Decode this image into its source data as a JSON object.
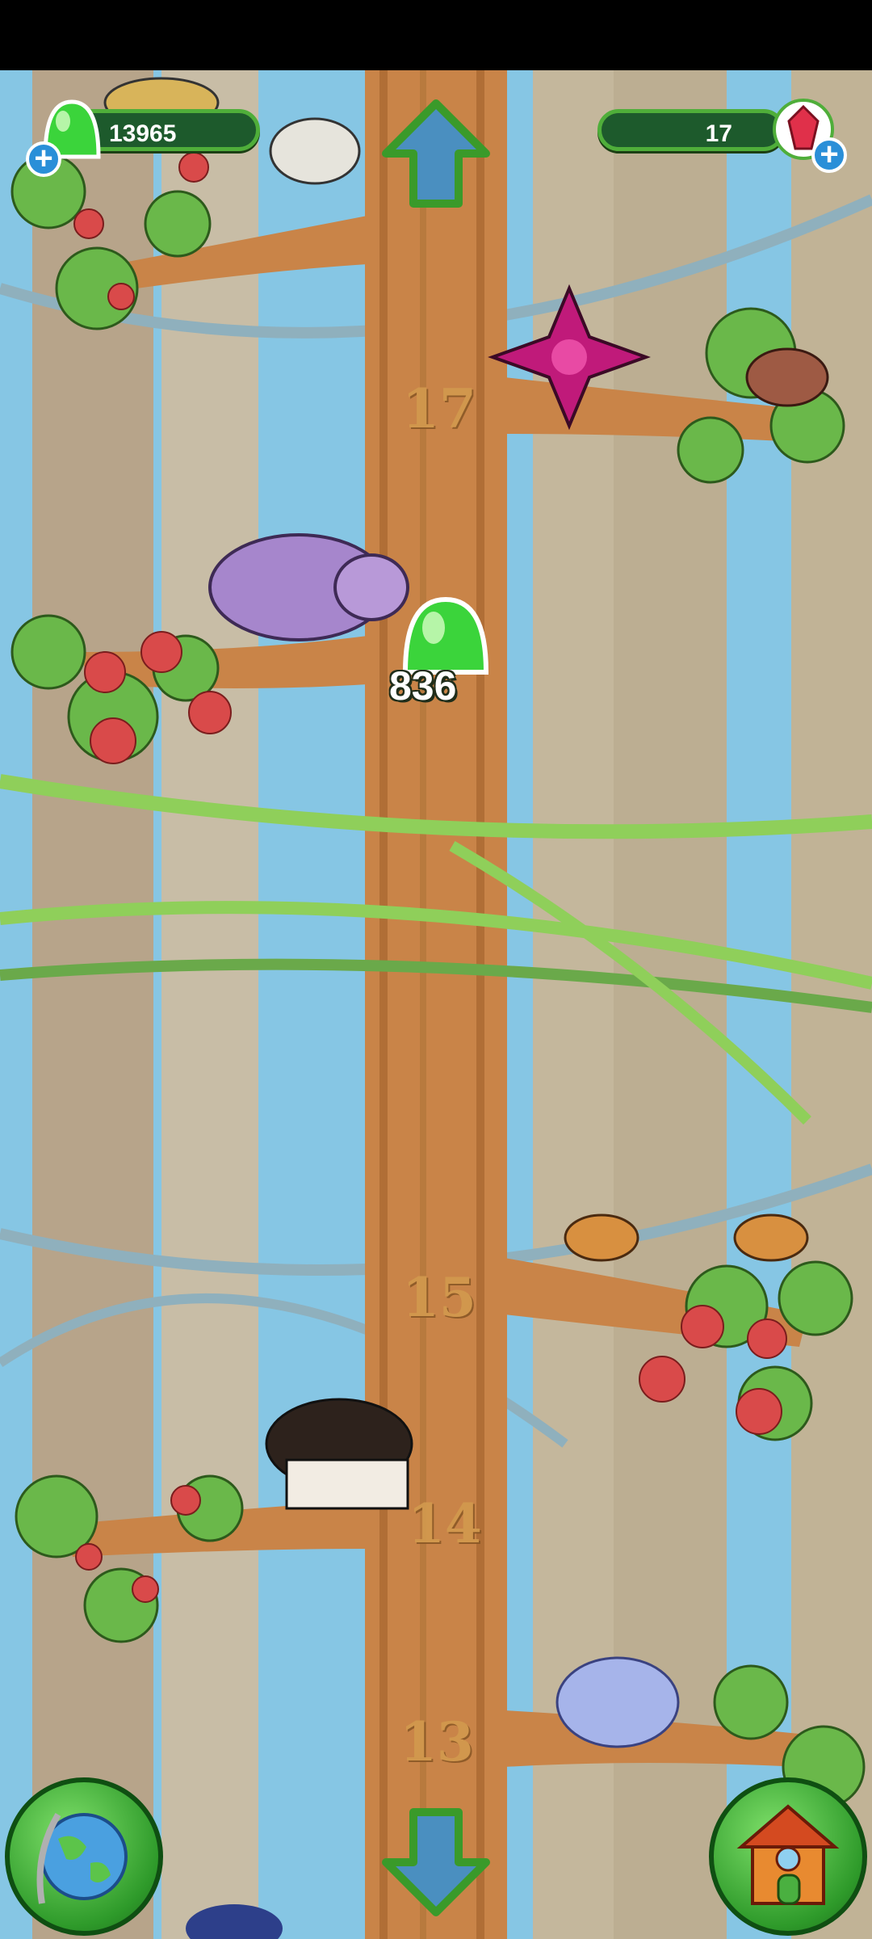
{
  "hud": {
    "jelly_count": "13965",
    "gem_count": "17",
    "jelly_plus": "+",
    "gem_plus": "+"
  },
  "tree": {
    "floors": [
      "17",
      "15",
      "14",
      "13"
    ]
  },
  "collectible": {
    "jelly_reward": "836"
  },
  "icons": {
    "jelly": "green-jelly-icon",
    "gem": "red-gem-icon",
    "up": "arrow-up-icon",
    "down": "arrow-down-icon",
    "world": "globe-icon",
    "home": "house-icon"
  },
  "colors": {
    "sky": "#86c6e4",
    "trunk": "#c98448",
    "hud_fill": "#1d5a2c",
    "hud_border": "#4fae3a",
    "button_green": "#3aa632"
  }
}
